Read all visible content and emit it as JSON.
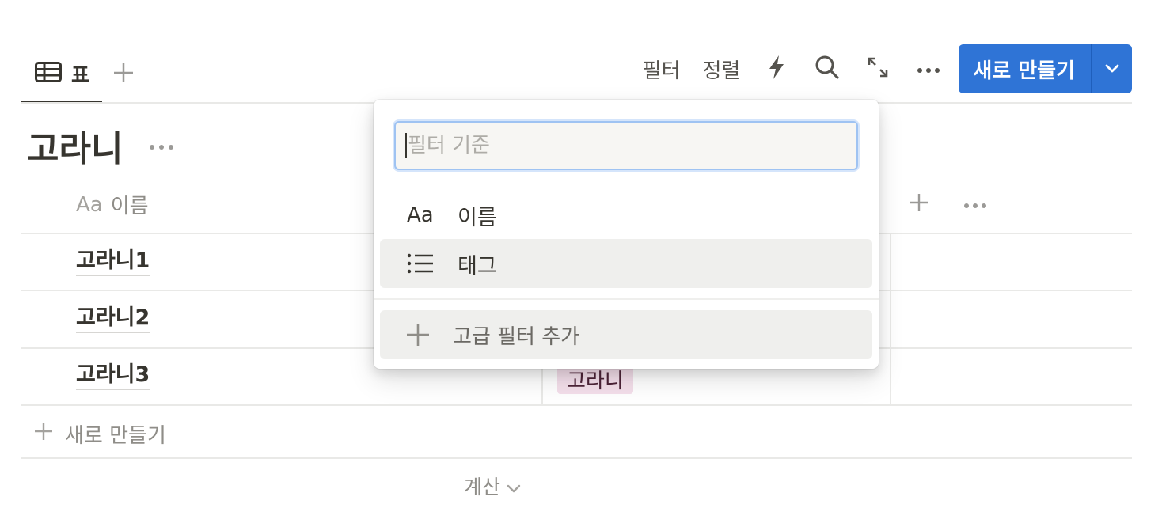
{
  "view_tabs": {
    "active_tab_label": "표",
    "active_tab_icon": "table-icon",
    "add_view_icon": "plus-icon"
  },
  "toolbar": {
    "filter_label": "필터",
    "sort_label": "정렬",
    "automation_icon": "lightning-icon",
    "search_icon": "search-icon",
    "expand_icon": "expand-arrows-icon",
    "more_icon": "more-dots-icon",
    "new_button_label": "새로 만들기",
    "new_button_caret_icon": "chevron-down-icon",
    "accent_color": "#2f74d6"
  },
  "database": {
    "title": "고라니",
    "title_more_icon": "more-dots-icon"
  },
  "table": {
    "name_column": {
      "type_icon": "Aa",
      "label": "이름"
    },
    "add_column_icon": "plus-icon",
    "column_more_icon": "more-dots-icon",
    "rows": [
      {
        "name": "고라니1"
      },
      {
        "name": "고라니2"
      },
      {
        "name": "고라니3",
        "tag": "고라니"
      }
    ],
    "tag_color": "#f4dfeb",
    "new_row_label": "새로 만들기",
    "calculate_label": "계산"
  },
  "filter_popup": {
    "search_placeholder": "필터 기준",
    "search_value": "",
    "options": [
      {
        "icon": "Aa",
        "label": "이름",
        "highlighted": false
      },
      {
        "icon": "list-icon",
        "label": "태그",
        "highlighted": true
      }
    ],
    "advanced_label": "고급 필터 추가",
    "advanced_icon": "plus-icon"
  }
}
